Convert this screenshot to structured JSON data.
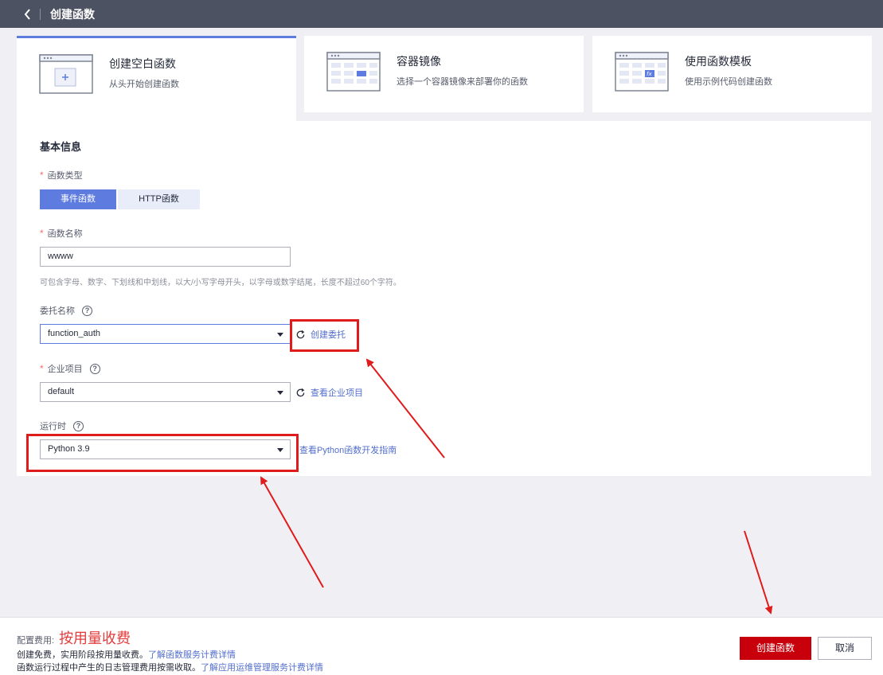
{
  "header": {
    "title": "创建函数"
  },
  "tiles": [
    {
      "title": "创建空白函数",
      "desc": "从头开始创建函数",
      "icon": "blank-function-icon"
    },
    {
      "title": "容器镜像",
      "desc": "选择一个容器镜像来部署你的函数",
      "icon": "container-image-icon"
    },
    {
      "title": "使用函数模板",
      "desc": "使用示例代码创建函数",
      "icon": "function-template-icon"
    }
  ],
  "form": {
    "section_title": "基本信息",
    "type": {
      "label": "函数类型",
      "options": [
        "事件函数",
        "HTTP函数"
      ],
      "selected": "事件函数"
    },
    "name": {
      "label": "函数名称",
      "value": "wwww",
      "hint": "可包含字母、数字、下划线和中划线，以大/小写字母开头，以字母或数字结尾，长度不超过60个字符。"
    },
    "agency": {
      "label": "委托名称",
      "value": "function_auth",
      "link": "创建委托"
    },
    "project": {
      "label": "企业项目",
      "value": "default",
      "link": "查看企业项目"
    },
    "runtime": {
      "label": "运行时",
      "value": "Python 3.9",
      "link": "查看Python函数开发指南"
    },
    "required_mark": "*",
    "help_mark": "?"
  },
  "footer": {
    "fee_label": "配置费用:",
    "fee_value": "按用量收费",
    "line1_text": "创建免费，实用阶段按用量收费。",
    "line1_link": "了解函数服务计费详情",
    "line2_text": "函数运行过程中产生的日志管理费用按需收取。",
    "line2_link": "了解应用运维管理服务计费详情",
    "create_label": "创建函数",
    "cancel_label": "取消"
  },
  "colors": {
    "accent": "#5e7ce0",
    "danger": "#c7000b",
    "annotation": "#e01b1b",
    "topbar": "#4d5263"
  }
}
